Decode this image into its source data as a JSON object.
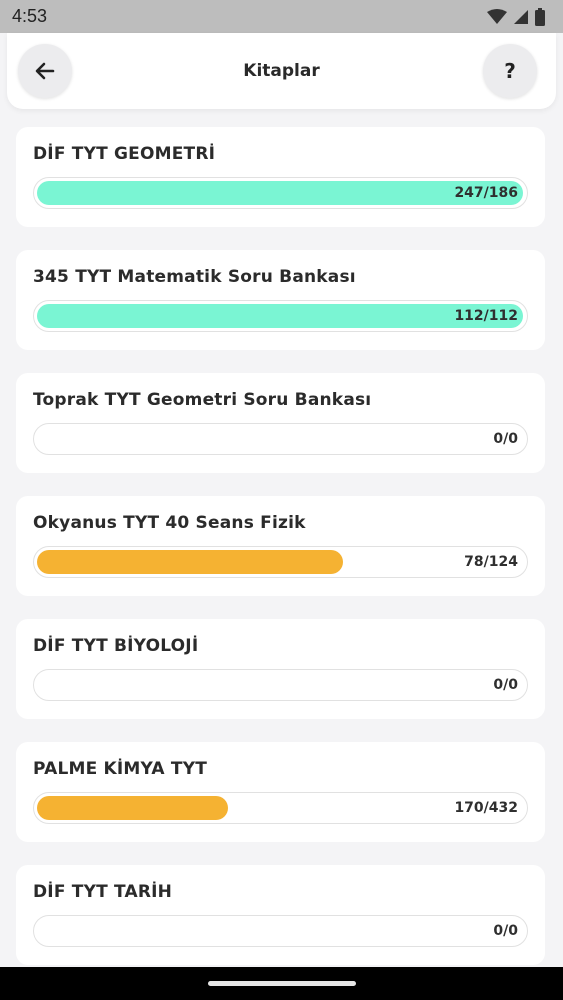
{
  "status_bar": {
    "time": "4:53"
  },
  "header": {
    "title": "Kitaplar",
    "help_label": "?"
  },
  "colors": {
    "complete": "#7af5d3",
    "partial": "#f5b232"
  },
  "books": [
    {
      "title": "DİF TYT GEOMETRİ",
      "progress": "247/186",
      "fill": 1.0,
      "status": "complete"
    },
    {
      "title": "345 TYT Matematik Soru Bankası",
      "progress": "112/112",
      "fill": 1.0,
      "status": "complete"
    },
    {
      "title": "Toprak TYT Geometri Soru Bankası",
      "progress": "0/0",
      "fill": 0.0,
      "status": "empty"
    },
    {
      "title": "Okyanus TYT 40 Seans Fizik",
      "progress": "78/124",
      "fill": 0.629,
      "status": "partial"
    },
    {
      "title": "DİF TYT BİYOLOJİ",
      "progress": "0/0",
      "fill": 0.0,
      "status": "empty"
    },
    {
      "title": "PALME KİMYA TYT",
      "progress": "170/432",
      "fill": 0.394,
      "status": "partial"
    },
    {
      "title": "DİF TYT TARİH",
      "progress": "0/0",
      "fill": 0.0,
      "status": "empty"
    }
  ]
}
